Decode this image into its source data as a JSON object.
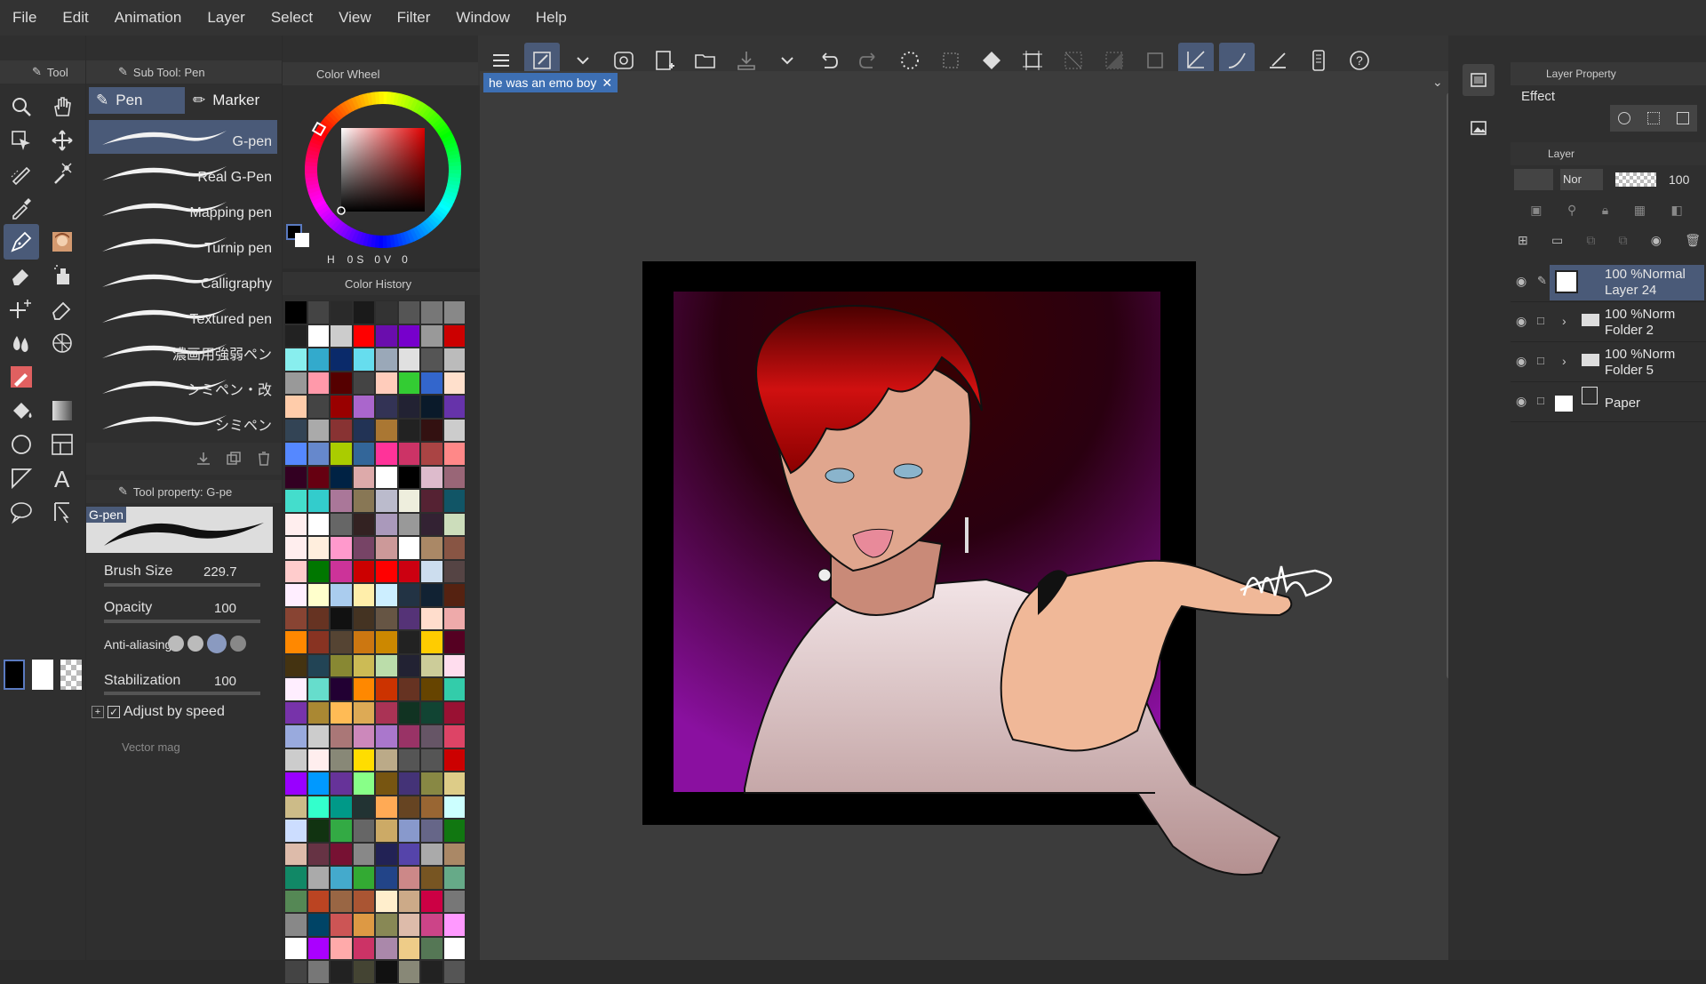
{
  "menu": [
    "File",
    "Edit",
    "Animation",
    "Layer",
    "Select",
    "View",
    "Filter",
    "Window",
    "Help"
  ],
  "panels": {
    "tool": "Tool",
    "subtool": "Sub Tool: Pen",
    "color_wheel": "Color Wheel",
    "color_history": "Color History",
    "tool_property": "Tool property: G-pe",
    "layer_property": "Layer Property",
    "layer": "Layer"
  },
  "subtool_tabs": [
    "Pen",
    "Marker"
  ],
  "pens": [
    "G-pen",
    "Real G-Pen",
    "Mapping pen",
    "Turnip pen",
    "Calligraphy",
    "Textured pen",
    "濃画用強弱ペン",
    "シミペン・改",
    "シミペン"
  ],
  "selected_pen": "G-pen",
  "color_values": {
    "h_label": "H",
    "h": "0",
    "s_label": "S",
    "s": "0",
    "v_label": "V",
    "v": "0"
  },
  "document_tab": "he was an emo boy",
  "tool_property": {
    "preview_name": "G-pen",
    "brush_size_label": "Brush Size",
    "brush_size": "229.7",
    "opacity_label": "Opacity",
    "opacity": "100",
    "antialiasing_label": "Anti-aliasing",
    "stabilization_label": "Stabilization",
    "stabilization": "100",
    "adjust_speed_label": "Adjust by speed",
    "vector_mag_label": "Vector mag"
  },
  "layer_property": {
    "effect_label": "Effect"
  },
  "layer_controls": {
    "blend_mode": "Nor",
    "opacity": "100"
  },
  "layers": [
    {
      "line1": "100 %Normal",
      "line2": "Layer 24",
      "selected": true,
      "type": "raster"
    },
    {
      "line1": "100 %Norm",
      "line2": "Folder 2",
      "selected": false,
      "type": "folder"
    },
    {
      "line1": "100 %Norm",
      "line2": "Folder 5",
      "selected": false,
      "type": "folder"
    },
    {
      "line1": "",
      "line2": "Paper",
      "selected": false,
      "type": "paper"
    }
  ],
  "colors": {
    "accent": "#4a5a78",
    "doc_tab": "#3d6fb3",
    "swatches": [
      "#000000",
      "#444444",
      "#2a2a2a",
      "#1a1a1a",
      "#333333",
      "#555555",
      "#777777",
      "#888888",
      "#222222",
      "#ffffff",
      "#cccccc",
      "#ff0000",
      "#6a0dad",
      "#7700cc",
      "#999999",
      "#cc0000",
      "#88eeee",
      "#33aacc",
      "#0a2a6a",
      "#66ddee",
      "#9aa8b8",
      "#e0e0e0",
      "#555555",
      "#bbbbbb",
      "#999999",
      "#ff99aa",
      "#550000",
      "#444444",
      "#ffccbb",
      "#33cc33",
      "#3366cc",
      "#ffe0cc",
      "#ffccaa",
      "#444444",
      "#990000",
      "#aa66cc",
      "#333355",
      "#222233",
      "#0a1a2a",
      "#6633aa",
      "#334455",
      "#aaaaaa",
      "#883333",
      "#223355",
      "#aa7733",
      "#222222",
      "#331111",
      "#cccccc",
      "#5588ff",
      "#6688cc",
      "#aacc00",
      "#336699",
      "#ff3399",
      "#cc3366",
      "#aa4444",
      "#ff8888",
      "#330022",
      "#660011",
      "#002244",
      "#ddaaaa",
      "#ffffff",
      "#000000",
      "#ddbbcc",
      "#996677",
      "#44ddcc",
      "#33cccc",
      "#aa7799",
      "#887755",
      "#bbbbcc",
      "#eeeedd",
      "#552233",
      "#115566",
      "#ffeeee",
      "#ffffff",
      "#666666",
      "#332222",
      "#aa99bb",
      "#999999",
      "#332233",
      "#ccddbb",
      "#ffeeee",
      "#ffeedd",
      "#ff99cc",
      "#774466",
      "#cc9999",
      "#ffffff",
      "#aa8866",
      "#885544",
      "#ffcccc",
      "#007700",
      "#cc3399",
      "#cc0000",
      "#ff0000",
      "#cc0011",
      "#ccddee",
      "#554444",
      "#ffeeff",
      "#ffffcc",
      "#aaccee",
      "#ffeeaa",
      "#cceeff",
      "#223344",
      "#112233",
      "#552211",
      "#884433",
      "#663322",
      "#111111",
      "#443322",
      "#665544",
      "#553377",
      "#ffddcc",
      "#eeaaaa",
      "#ff8800",
      "#883322",
      "#554433",
      "#cc7711",
      "#cc8800",
      "#222222",
      "#ffcc00",
      "#550022",
      "#443311",
      "#224455",
      "#888833",
      "#ccbb55",
      "#bbddaa",
      "#222233",
      "#cccc99",
      "#ffddee",
      "#ffeeff",
      "#66ddcc",
      "#220033",
      "#ff8800",
      "#cc3300",
      "#663322",
      "#664400",
      "#33ccaa",
      "#7733aa",
      "#aa8833",
      "#ffbb55",
      "#ddaa55",
      "#aa3355",
      "#113322",
      "#114433",
      "#991133",
      "#99aadd",
      "#cccccc",
      "#aa7777",
      "#cc88bb",
      "#aa77cc",
      "#993366",
      "#665566",
      "#dd4466",
      "#cccccc",
      "#ffeeee",
      "#888877",
      "#ffdd00",
      "#bbaa88",
      "#555555",
      "#555555",
      "#cc0000",
      "#9900ff",
      "#0099ff",
      "#663399",
      "#88ff88",
      "#775511",
      "#443377",
      "#888844",
      "#ddcc88",
      "#ccbb88",
      "#33ffcc",
      "#009988",
      "#223333",
      "#ffaa55",
      "#664422",
      "#996633",
      "#ccffff",
      "#ccddff",
      "#113311",
      "#33aa44",
      "#666666",
      "#ccaa66",
      "#8899cc",
      "#666688",
      "#117711",
      "#ddbbaa",
      "#663344",
      "#771133",
      "#888888",
      "#222255",
      "#5544aa",
      "#aaaaaa",
      "#aa8866",
      "#118866",
      "#aaaaaa",
      "#44aacc",
      "#33aa33",
      "#224488",
      "#cc8888",
      "#775522",
      "#66aa88",
      "#558855",
      "#bb4422",
      "#996644",
      "#aa5533",
      "#ffeecc",
      "#ccaa88",
      "#cc0044",
      "#777777",
      "#888888",
      "#004466",
      "#cc5555",
      "#dd9944",
      "#888855",
      "#ddbbaa",
      "#cc4488",
      "#ff99ff",
      "#ffffff",
      "#aa00ff",
      "#ffaaaa",
      "#cc3366",
      "#aa88aa",
      "#eecc88",
      "#557755",
      "#ffffff",
      "#444444",
      "#777777",
      "#222222",
      "#444433",
      "#111111",
      "#888877",
      "#222222",
      "#555555"
    ]
  }
}
